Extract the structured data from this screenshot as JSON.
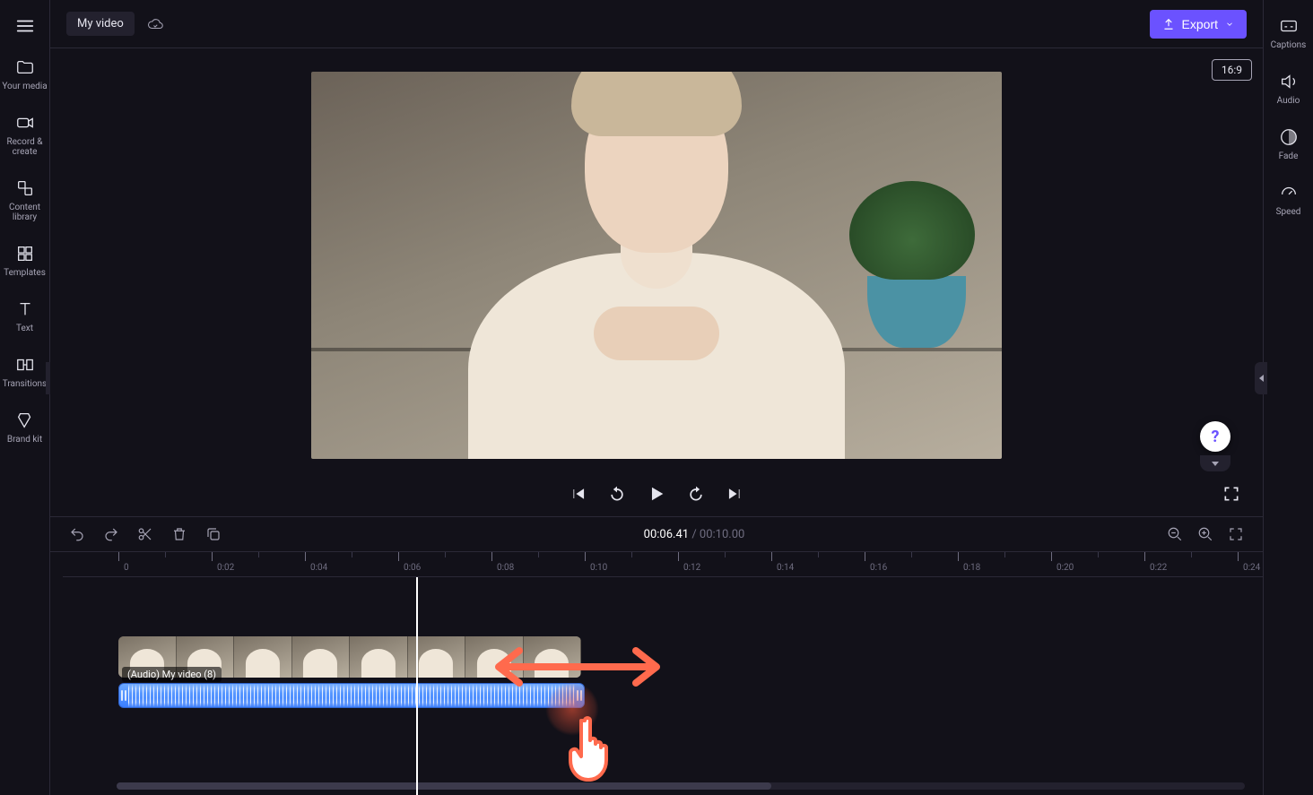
{
  "header": {
    "project_title": "My video",
    "export_label": "Export",
    "aspect_ratio": "16:9"
  },
  "left_rail": {
    "items": [
      {
        "id": "your-media",
        "label": "Your media"
      },
      {
        "id": "record-create",
        "label": "Record & create"
      },
      {
        "id": "content-library",
        "label": "Content library"
      },
      {
        "id": "templates",
        "label": "Templates"
      },
      {
        "id": "text",
        "label": "Text"
      },
      {
        "id": "transitions",
        "label": "Transitions"
      },
      {
        "id": "brand-kit",
        "label": "Brand kit"
      }
    ]
  },
  "right_rail": {
    "items": [
      {
        "id": "captions",
        "label": "Captions"
      },
      {
        "id": "audio",
        "label": "Audio"
      },
      {
        "id": "fade",
        "label": "Fade"
      },
      {
        "id": "speed",
        "label": "Speed"
      }
    ]
  },
  "playback": {
    "current_time": "00:06.41",
    "separator": "/",
    "duration": "00:10.00"
  },
  "ruler": {
    "labels": [
      "0",
      "0:02",
      "0:04",
      "0:06",
      "0:08",
      "0:10",
      "0:12",
      "0:14",
      "0:16",
      "0:18",
      "0:20",
      "0:22",
      "0:24"
    ]
  },
  "timeline": {
    "audio_clip_label": "(Audio) My video (8)"
  },
  "help_fab": "?"
}
